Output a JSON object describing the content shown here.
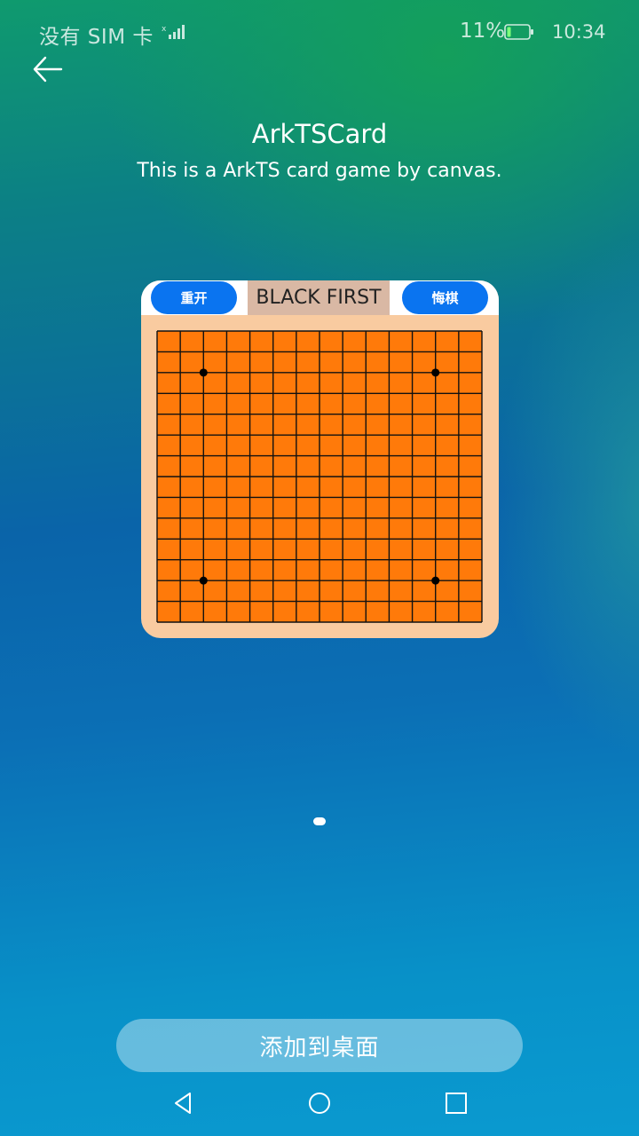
{
  "status_bar": {
    "carrier": "没有 SIM 卡",
    "signal_icon": "signal-icon",
    "battery_percent": "11%",
    "battery_icon": "battery-icon",
    "time": "10:34"
  },
  "header": {
    "back_icon": "arrow-left-icon",
    "title": "ArkTSCard",
    "subtitle": "This is a ArkTS card game by canvas."
  },
  "card": {
    "restart_label": "重开",
    "turn_status": "BLACK FIRST",
    "undo_label": "悔棋",
    "board": {
      "grid_lines": 15,
      "line_color": "#111111",
      "cell_color": "#ff7a0a",
      "star_points": [
        [
          2,
          2
        ],
        [
          12,
          2
        ],
        [
          2,
          12
        ],
        [
          12,
          12
        ]
      ]
    },
    "colors": {
      "card_bg": "#f9cba0",
      "button_bg": "#0a74f0",
      "status_bg": "#d9b8a4"
    }
  },
  "pager": {
    "total": 1,
    "active": 0
  },
  "actions": {
    "add_label": "添加到桌面"
  },
  "nav_bar": {
    "back_icon": "triangle-back-icon",
    "home_icon": "circle-home-icon",
    "recent_icon": "square-recent-icon"
  }
}
